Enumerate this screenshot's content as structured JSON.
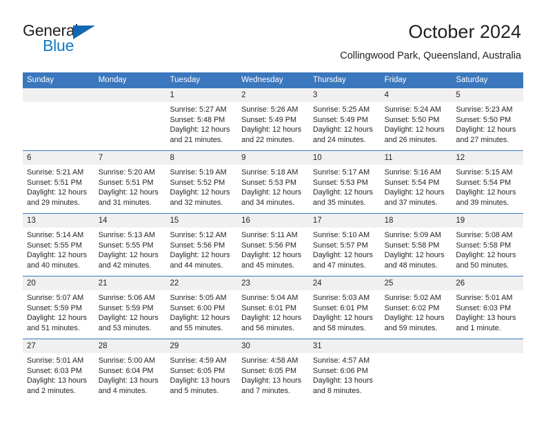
{
  "brand": {
    "name_top": "General",
    "name_bottom": "Blue",
    "triangle_color": "#1068b3",
    "blue_text_color": "#1279c4"
  },
  "header": {
    "title": "October 2024",
    "subtitle": "Collingwood Park, Queensland, Australia"
  },
  "theme": {
    "header_blue": "#3b77bd",
    "daynum_band": "#f0f0f0",
    "text": "#231f20"
  },
  "weekday_headers": [
    "Sunday",
    "Monday",
    "Tuesday",
    "Wednesday",
    "Thursday",
    "Friday",
    "Saturday"
  ],
  "weeks": [
    [
      {
        "day": "",
        "sunrise": "",
        "sunset": "",
        "daylight": "",
        "empty": true
      },
      {
        "day": "",
        "sunrise": "",
        "sunset": "",
        "daylight": "",
        "empty": true
      },
      {
        "day": "1",
        "sunrise": "Sunrise: 5:27 AM",
        "sunset": "Sunset: 5:48 PM",
        "daylight": "Daylight: 12 hours and 21 minutes."
      },
      {
        "day": "2",
        "sunrise": "Sunrise: 5:26 AM",
        "sunset": "Sunset: 5:49 PM",
        "daylight": "Daylight: 12 hours and 22 minutes."
      },
      {
        "day": "3",
        "sunrise": "Sunrise: 5:25 AM",
        "sunset": "Sunset: 5:49 PM",
        "daylight": "Daylight: 12 hours and 24 minutes."
      },
      {
        "day": "4",
        "sunrise": "Sunrise: 5:24 AM",
        "sunset": "Sunset: 5:50 PM",
        "daylight": "Daylight: 12 hours and 26 minutes."
      },
      {
        "day": "5",
        "sunrise": "Sunrise: 5:23 AM",
        "sunset": "Sunset: 5:50 PM",
        "daylight": "Daylight: 12 hours and 27 minutes."
      }
    ],
    [
      {
        "day": "6",
        "sunrise": "Sunrise: 5:21 AM",
        "sunset": "Sunset: 5:51 PM",
        "daylight": "Daylight: 12 hours and 29 minutes."
      },
      {
        "day": "7",
        "sunrise": "Sunrise: 5:20 AM",
        "sunset": "Sunset: 5:51 PM",
        "daylight": "Daylight: 12 hours and 31 minutes."
      },
      {
        "day": "8",
        "sunrise": "Sunrise: 5:19 AM",
        "sunset": "Sunset: 5:52 PM",
        "daylight": "Daylight: 12 hours and 32 minutes."
      },
      {
        "day": "9",
        "sunrise": "Sunrise: 5:18 AM",
        "sunset": "Sunset: 5:53 PM",
        "daylight": "Daylight: 12 hours and 34 minutes."
      },
      {
        "day": "10",
        "sunrise": "Sunrise: 5:17 AM",
        "sunset": "Sunset: 5:53 PM",
        "daylight": "Daylight: 12 hours and 35 minutes."
      },
      {
        "day": "11",
        "sunrise": "Sunrise: 5:16 AM",
        "sunset": "Sunset: 5:54 PM",
        "daylight": "Daylight: 12 hours and 37 minutes."
      },
      {
        "day": "12",
        "sunrise": "Sunrise: 5:15 AM",
        "sunset": "Sunset: 5:54 PM",
        "daylight": "Daylight: 12 hours and 39 minutes."
      }
    ],
    [
      {
        "day": "13",
        "sunrise": "Sunrise: 5:14 AM",
        "sunset": "Sunset: 5:55 PM",
        "daylight": "Daylight: 12 hours and 40 minutes."
      },
      {
        "day": "14",
        "sunrise": "Sunrise: 5:13 AM",
        "sunset": "Sunset: 5:55 PM",
        "daylight": "Daylight: 12 hours and 42 minutes."
      },
      {
        "day": "15",
        "sunrise": "Sunrise: 5:12 AM",
        "sunset": "Sunset: 5:56 PM",
        "daylight": "Daylight: 12 hours and 44 minutes."
      },
      {
        "day": "16",
        "sunrise": "Sunrise: 5:11 AM",
        "sunset": "Sunset: 5:56 PM",
        "daylight": "Daylight: 12 hours and 45 minutes."
      },
      {
        "day": "17",
        "sunrise": "Sunrise: 5:10 AM",
        "sunset": "Sunset: 5:57 PM",
        "daylight": "Daylight: 12 hours and 47 minutes."
      },
      {
        "day": "18",
        "sunrise": "Sunrise: 5:09 AM",
        "sunset": "Sunset: 5:58 PM",
        "daylight": "Daylight: 12 hours and 48 minutes."
      },
      {
        "day": "19",
        "sunrise": "Sunrise: 5:08 AM",
        "sunset": "Sunset: 5:58 PM",
        "daylight": "Daylight: 12 hours and 50 minutes."
      }
    ],
    [
      {
        "day": "20",
        "sunrise": "Sunrise: 5:07 AM",
        "sunset": "Sunset: 5:59 PM",
        "daylight": "Daylight: 12 hours and 51 minutes."
      },
      {
        "day": "21",
        "sunrise": "Sunrise: 5:06 AM",
        "sunset": "Sunset: 5:59 PM",
        "daylight": "Daylight: 12 hours and 53 minutes."
      },
      {
        "day": "22",
        "sunrise": "Sunrise: 5:05 AM",
        "sunset": "Sunset: 6:00 PM",
        "daylight": "Daylight: 12 hours and 55 minutes."
      },
      {
        "day": "23",
        "sunrise": "Sunrise: 5:04 AM",
        "sunset": "Sunset: 6:01 PM",
        "daylight": "Daylight: 12 hours and 56 minutes."
      },
      {
        "day": "24",
        "sunrise": "Sunrise: 5:03 AM",
        "sunset": "Sunset: 6:01 PM",
        "daylight": "Daylight: 12 hours and 58 minutes."
      },
      {
        "day": "25",
        "sunrise": "Sunrise: 5:02 AM",
        "sunset": "Sunset: 6:02 PM",
        "daylight": "Daylight: 12 hours and 59 minutes."
      },
      {
        "day": "26",
        "sunrise": "Sunrise: 5:01 AM",
        "sunset": "Sunset: 6:03 PM",
        "daylight": "Daylight: 13 hours and 1 minute."
      }
    ],
    [
      {
        "day": "27",
        "sunrise": "Sunrise: 5:01 AM",
        "sunset": "Sunset: 6:03 PM",
        "daylight": "Daylight: 13 hours and 2 minutes."
      },
      {
        "day": "28",
        "sunrise": "Sunrise: 5:00 AM",
        "sunset": "Sunset: 6:04 PM",
        "daylight": "Daylight: 13 hours and 4 minutes."
      },
      {
        "day": "29",
        "sunrise": "Sunrise: 4:59 AM",
        "sunset": "Sunset: 6:05 PM",
        "daylight": "Daylight: 13 hours and 5 minutes."
      },
      {
        "day": "30",
        "sunrise": "Sunrise: 4:58 AM",
        "sunset": "Sunset: 6:05 PM",
        "daylight": "Daylight: 13 hours and 7 minutes."
      },
      {
        "day": "31",
        "sunrise": "Sunrise: 4:57 AM",
        "sunset": "Sunset: 6:06 PM",
        "daylight": "Daylight: 13 hours and 8 minutes."
      },
      {
        "day": "",
        "sunrise": "",
        "sunset": "",
        "daylight": "",
        "empty": true
      },
      {
        "day": "",
        "sunrise": "",
        "sunset": "",
        "daylight": "",
        "empty": true
      }
    ]
  ]
}
